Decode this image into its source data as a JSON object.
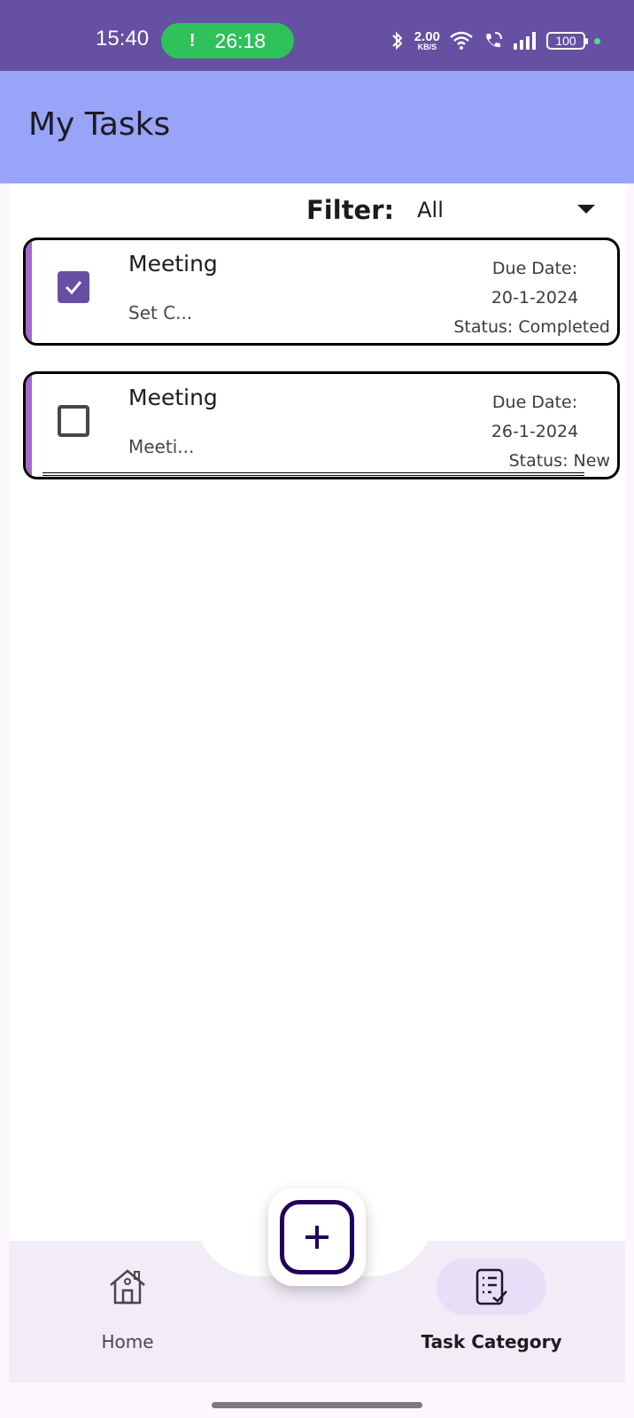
{
  "status_bar": {
    "time": "15:40",
    "call_timer": "26:18",
    "call_icon": "!",
    "net_speed_value": "2.00",
    "net_speed_unit": "KB/S",
    "battery": "100",
    "icons": [
      "bluetooth-icon",
      "wifi-icon",
      "wifi-call-icon",
      "signal-icon",
      "battery-icon"
    ]
  },
  "app_bar": {
    "title": "My Tasks"
  },
  "filter": {
    "label": "Filter:",
    "value": "All"
  },
  "tasks": [
    {
      "title": "Meeting",
      "description": "Set C...",
      "due_label": "Due Date:",
      "due_date": "20-1-2024",
      "status": "Status: Completed",
      "checked": true
    },
    {
      "title": "Meeting",
      "description": "Meeti...",
      "due_label": "Due Date:",
      "due_date": "26-1-2024",
      "status": "Status: New",
      "checked": false
    }
  ],
  "bottom_nav": {
    "items": [
      {
        "label": "Home",
        "icon": "home-icon",
        "selected": false
      },
      {
        "label": "Task Category",
        "icon": "task-list-icon",
        "selected": true
      }
    ]
  },
  "fab": {
    "icon": "add-icon"
  },
  "colors": {
    "status_bar": "#6550a2",
    "app_bar": "#98a4f7",
    "accent": "#6750a4",
    "card_stripe": "#a36bc9",
    "call_pill": "#2fc15a"
  }
}
